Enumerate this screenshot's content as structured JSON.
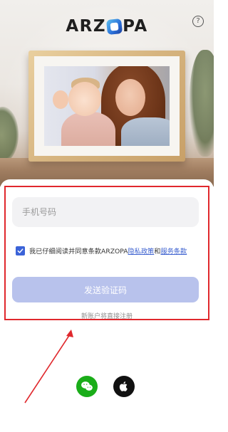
{
  "header": {
    "logo_text_left": "ARZ",
    "logo_text_right": "PA",
    "help_icon": "?"
  },
  "form": {
    "phone_placeholder": "手机号码",
    "phone_value": "",
    "agreement_checked": true,
    "agreement_prefix": "我已仔细阅读并同意条款ARZOPA",
    "privacy_link": "隐私政策",
    "and_text": "和",
    "terms_link": "服务条款",
    "send_code_label": "发送验证码",
    "register_hint": "新账户将直接注册"
  },
  "social": {
    "wechat_icon": "wechat-icon",
    "apple_icon": "apple-icon"
  },
  "colors": {
    "accent": "#3b63d8",
    "button_disabled": "#b8c2ec",
    "annotation_red": "#e0282d",
    "wechat_green": "#1aad19"
  }
}
